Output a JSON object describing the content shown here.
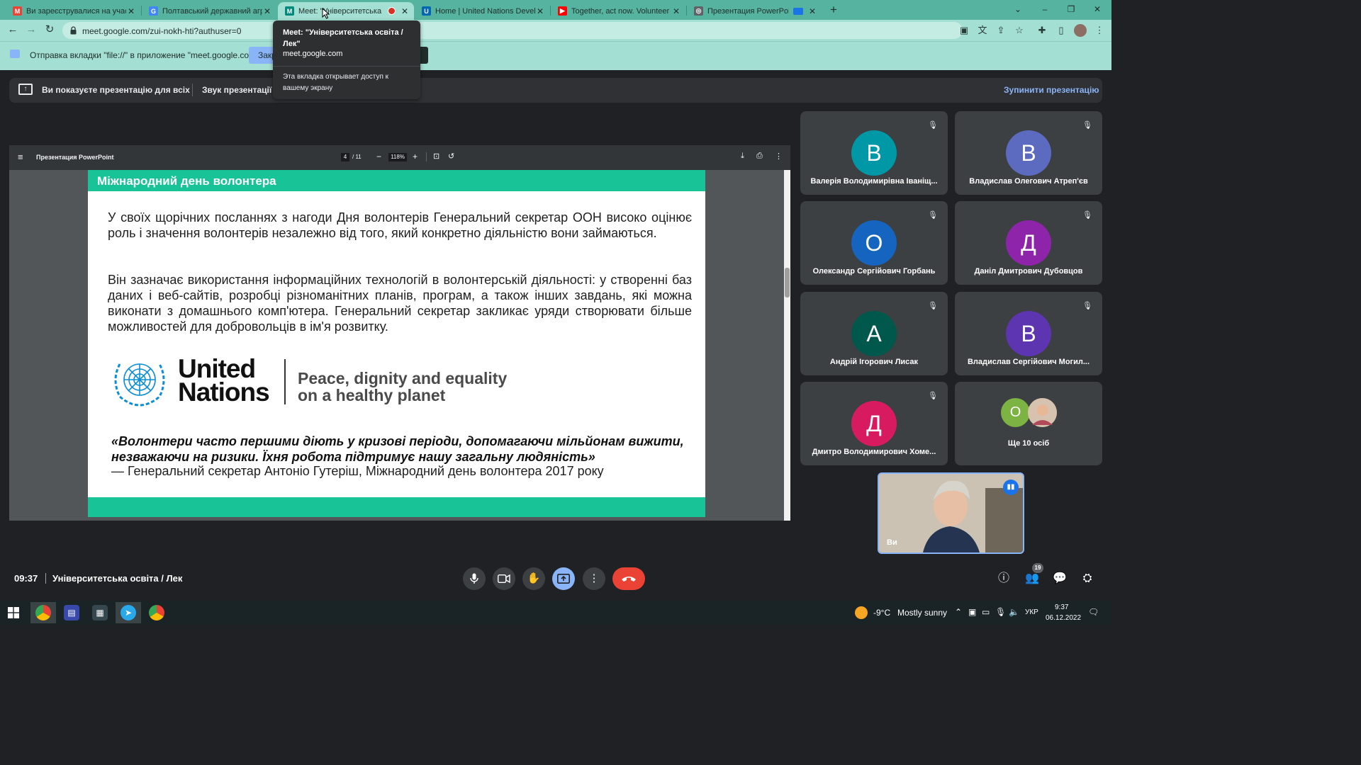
{
  "browser": {
    "tabs": [
      {
        "title": "Ви зареєструвалися на участь у",
        "favicon": "gmail-icon",
        "favicon_color": "#ea4335",
        "favicon_letter": "M"
      },
      {
        "title": "Полтавський державний аграр",
        "favicon": "google-sites-icon",
        "favicon_color": "#4285f4",
        "favicon_letter": "G"
      },
      {
        "title": "Meet: \"Університетська осві",
        "favicon": "meet-icon",
        "favicon_color": "#00897b",
        "favicon_letter": "M",
        "active": true,
        "sharing": true
      },
      {
        "title": "Home | United Nations Develop",
        "favicon": "un-icon",
        "favicon_color": "#0468b1",
        "favicon_letter": "U"
      },
      {
        "title": "Together, act now. Volunteer for",
        "favicon": "youtube-icon",
        "favicon_color": "#ff0000",
        "favicon_letter": "▶"
      },
      {
        "title": "Презентация PowerPoint",
        "favicon": "globe-icon",
        "favicon_color": "#5f6368",
        "favicon_letter": "◎"
      }
    ],
    "new_tab": "+",
    "window_controls": {
      "tab_search": "⌄",
      "minimize": "–",
      "maximize": "❐",
      "close": "✕"
    },
    "url": "meet.google.com/zui-nokh-hti?authuser=0",
    "infobar": {
      "text": "Отправка вкладки \"file://\" в приложение \"meet.google.com\"...",
      "button": "Закрыть"
    },
    "tooltip": {
      "title": "Meet: \"Університетська освіта / Лек\"",
      "domain": "meet.google.com",
      "desc": "Эта вкладка открывает доступ к вашему экрану"
    }
  },
  "meet": {
    "presenting_text": "Ви показуєте презентацію для всіх",
    "audio_text": "Звук презентації",
    "stop_presenting": "Зупинити презентацію",
    "clock": "09:37",
    "meeting_title": "Університетська освіта / Лек",
    "participants": [
      {
        "initial": "В",
        "name": "Валерія Володимирівна Іваніщ...",
        "color": "#0097a7",
        "muted": true
      },
      {
        "initial": "В",
        "name": "Владислав Олегович Атреп'єв",
        "color": "#5c6bc0",
        "muted": true
      },
      {
        "initial": "О",
        "name": "Олександр Сергійович Горбань",
        "color": "#1565c0",
        "muted": true
      },
      {
        "initial": "Д",
        "name": "Даніл Дмитрович Дубовцов",
        "color": "#8e24aa",
        "muted": true
      },
      {
        "initial": "А",
        "name": "Андрій Ігорович Лисак",
        "color": "#00574b",
        "muted": true
      },
      {
        "initial": "В",
        "name": "Владислав Сергійович Могил...",
        "color": "#5e35b1",
        "muted": true
      },
      {
        "initial": "Д",
        "name": "Дмитро Володимирович Хоме...",
        "color": "#d81b60",
        "muted": true
      }
    ],
    "more": {
      "initial": "О",
      "label": "Ще 10 осіб"
    },
    "self_label": "Ви",
    "people_count": "19"
  },
  "pdf": {
    "title": "Презентация PowerPoint",
    "page": "4",
    "total": "/ 11",
    "zoom": "118%"
  },
  "slide": {
    "heading": "Міжнародний день волонтера",
    "para1": "У своїх щорічних посланнях з нагоди Дня волонтерів Генеральний секретар ООН високо оцінює роль і значення волонтерів незалежно від того, який конкретно діяльністю вони займаються.",
    "para2": "Він зазначає використання інформаційних технологій в волонтерській діяльності: у створенні баз даних і веб-сайтів, розробці різноманітних планів, програм, а також інших завдань, які можна виконати з домашнього комп'ютера. Генеральний секретар закликає уряди створювати більше можливостей для добровольців в ім'я розвитку.",
    "un_name_line1": "United",
    "un_name_line2": "Nations",
    "un_tagline_line1": "Peace, dignity and equality",
    "un_tagline_line2": "on a healthy planet",
    "quote": "«Волонтери часто першими діють у кризові періоди, допомагаючи мільйонам вижити, незважаючи на ризики. Їхня робота підтримує нашу загальну людяність»",
    "quote_source": "— Генеральний секретар Антоніо Гутеріш, Міжнародний день волонтера 2017 року"
  },
  "taskbar": {
    "weather_temp": "-9°C",
    "weather_desc": "Mostly sunny",
    "lang": "УКР",
    "time": "9:37",
    "date": "06.12.2022"
  }
}
